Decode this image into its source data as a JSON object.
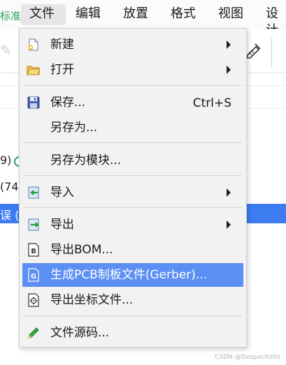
{
  "menubar": {
    "partial_left": "标准",
    "items": [
      "文件",
      "编辑",
      "放置",
      "格式",
      "视图",
      "设计"
    ]
  },
  "background": {
    "row1": "9)",
    "row2": "(74",
    "row3": "误 ("
  },
  "file_menu": {
    "new": "新建",
    "open": "打开",
    "save": "保存...",
    "save_shortcut": "Ctrl+S",
    "save_as": "另存为...",
    "save_as_module": "另存为模块...",
    "import": "导入",
    "export": "导出",
    "export_bom": "导出BOM...",
    "gen_gerber": "生成PCB制板文件(Gerber)...",
    "export_coords": "导出坐标文件...",
    "file_source": "文件源码..."
  },
  "watermark": "CSDN @Despacito0o",
  "colors": {
    "highlight": "#5b8ff4",
    "selection": "#3d7bf0",
    "accent_green": "#2aa35a"
  },
  "icons": [
    "new-file-icon",
    "open-folder-icon",
    "save-disk-icon",
    "import-icon",
    "export-icon",
    "bom-icon",
    "gerber-icon",
    "coordinates-icon",
    "pencil-icon"
  ]
}
